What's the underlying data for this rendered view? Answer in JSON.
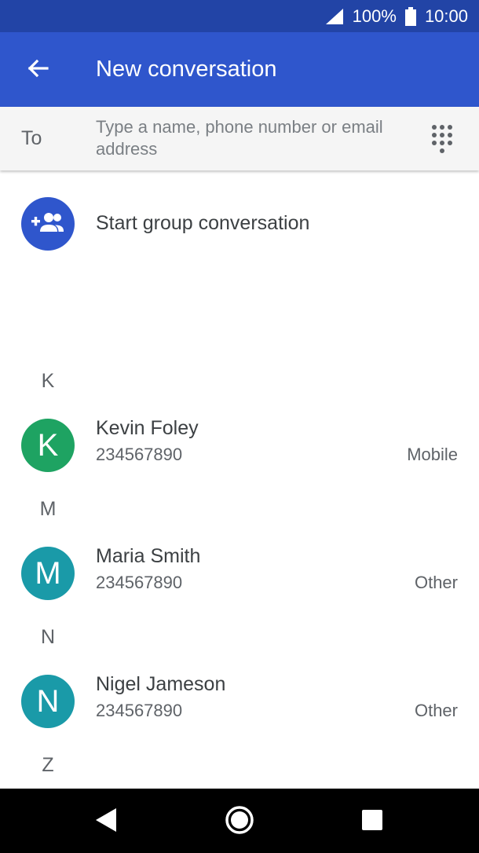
{
  "status_bar": {
    "battery": "100%",
    "time": "10:00",
    "icons": [
      "signal-icon",
      "battery-icon"
    ]
  },
  "app_bar": {
    "title": "New conversation",
    "back_icon": "arrow-back-icon"
  },
  "to_field": {
    "label": "To",
    "placeholder": "Type a name, phone number or email address",
    "dialpad_icon": "dialpad-icon"
  },
  "group": {
    "label": "Start group conversation",
    "icon": "group-add-icon"
  },
  "sections": [
    {
      "letter": "K",
      "contacts": [
        {
          "initial": "K",
          "name": "Kevin Foley",
          "number": "234567890",
          "type": "Mobile",
          "color": "#1ea362"
        }
      ]
    },
    {
      "letter": "M",
      "contacts": [
        {
          "initial": "M",
          "name": "Maria Smith",
          "number": "234567890",
          "type": "Other",
          "color": "#1a9aa8"
        }
      ]
    },
    {
      "letter": "N",
      "contacts": [
        {
          "initial": "N",
          "name": "Nigel Jameson",
          "number": "234567890",
          "type": "Other",
          "color": "#1a9aa8"
        }
      ]
    },
    {
      "letter": "Z",
      "contacts": []
    }
  ],
  "nav": {
    "back_icon": "nav-back-icon",
    "home_icon": "nav-home-icon",
    "recents_icon": "nav-recents-icon"
  },
  "colors": {
    "status_bar": "#2244a6",
    "app_bar": "#2f56cc",
    "accent": "#2f56cc"
  }
}
